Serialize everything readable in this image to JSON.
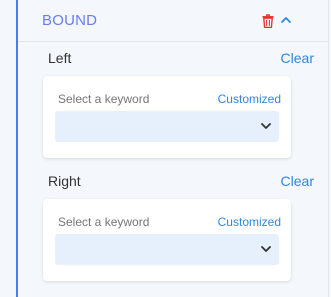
{
  "header": {
    "title": "BOUND",
    "icons": [
      "trash-icon",
      "chevron-up-icon"
    ]
  },
  "sections": [
    {
      "label": "Left",
      "clear_label": "Clear",
      "placeholder": "Select a keyword",
      "customized_label": "Customized"
    },
    {
      "label": "Right",
      "clear_label": "Clear",
      "placeholder": "Select a keyword",
      "customized_label": "Customized"
    }
  ],
  "colors": {
    "accent": "#3d82ef",
    "title": "#6b7bf0",
    "link": "#2f86e6",
    "delete": "#e53935",
    "select_bg": "#e6f0fd"
  }
}
